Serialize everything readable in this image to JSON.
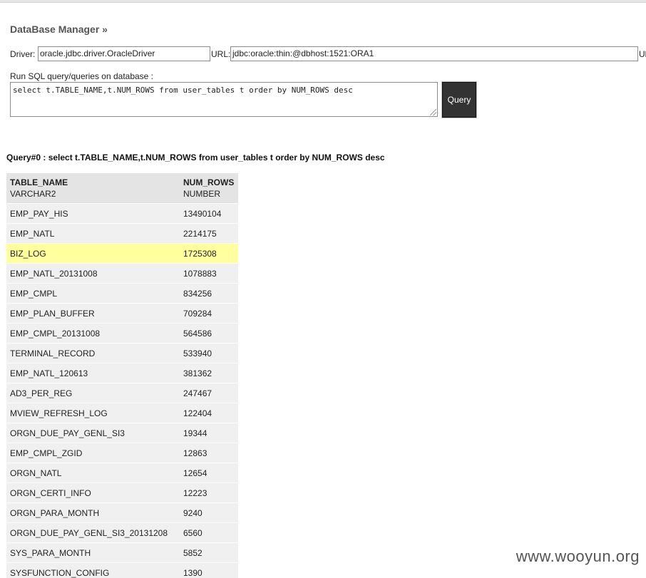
{
  "header": {
    "title": "DataBase Manager »"
  },
  "form": {
    "driver_label": "Driver:",
    "driver_value": "oracle.jdbc.driver.OracleDriver",
    "url_label": "URL:",
    "url_value": "jdbc:oracle:thin:@dbhost:1521:ORA1",
    "clipped_label": "Ul",
    "sql_label": "Run SQL query/queries on database :",
    "sql_value": "select t.TABLE_NAME,t.NUM_ROWS from user_tables t order by NUM_ROWS desc",
    "query_button": "Query"
  },
  "results": {
    "heading": "Query#0 : select t.TABLE_NAME,t.NUM_ROWS from user_tables t order by NUM_ROWS desc",
    "columns": [
      {
        "name": "TABLE_NAME",
        "type": "VARCHAR2"
      },
      {
        "name": "NUM_ROWS",
        "type": "NUMBER"
      }
    ],
    "rows": [
      [
        "EMP_PAY_HIS",
        "13490104"
      ],
      [
        "EMP_NATL",
        "2214175"
      ],
      [
        "BIZ_LOG",
        "1725308"
      ],
      [
        "EMP_NATL_20131008",
        "1078883"
      ],
      [
        "EMP_CMPL",
        "834256"
      ],
      [
        "EMP_PLAN_BUFFER",
        "709284"
      ],
      [
        "EMP_CMPL_20131008",
        "564586"
      ],
      [
        "TERMINAL_RECORD",
        "533940"
      ],
      [
        "EMP_NATL_120613",
        "381362"
      ],
      [
        "AD3_PER_REG",
        "247467"
      ],
      [
        "MVIEW_REFRESH_LOG",
        "122404"
      ],
      [
        "ORGN_DUE_PAY_GENL_SI3",
        "19344"
      ],
      [
        "EMP_CMPL_ZGID",
        "12863"
      ],
      [
        "ORGN_NATL",
        "12654"
      ],
      [
        "ORGN_CERTI_INFO",
        "12223"
      ],
      [
        "ORGN_PARA_MONTH",
        "9240"
      ],
      [
        "ORGN_DUE_PAY_GENL_SI3_20131208",
        "6560"
      ],
      [
        "SYS_PARA_MONTH",
        "5852"
      ],
      [
        "SYSFUNCTION_CONFIG",
        "1390"
      ]
    ],
    "highlighted_row": 2,
    "highlight_color": "#ffff9e"
  },
  "watermark": "www.wooyun.org"
}
